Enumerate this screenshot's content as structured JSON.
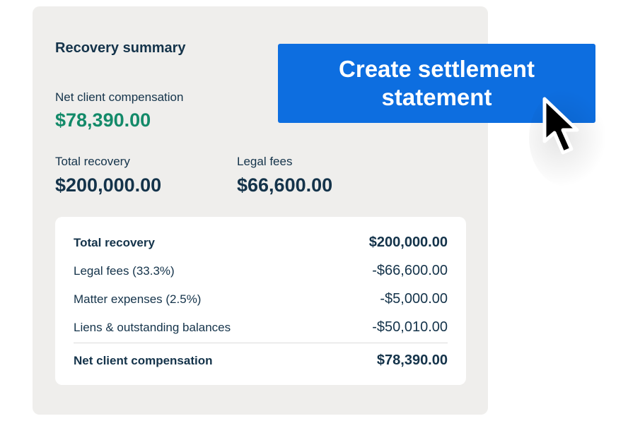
{
  "summary": {
    "title": "Recovery summary",
    "net_label": "Net client compensation",
    "net_value": "$78,390.00",
    "total_label": "Total recovery",
    "total_value": "$200,000.00",
    "fees_label": "Legal fees",
    "fees_value": "$66,600.00"
  },
  "breakdown": {
    "rows": [
      {
        "label": "Total recovery",
        "value": "$200,000.00"
      },
      {
        "label": "Legal fees (33.3%)",
        "value": "-$66,600.00"
      },
      {
        "label": "Matter expenses (2.5%)",
        "value": "-$5,000.00"
      },
      {
        "label": "Liens & outstanding balances",
        "value": "-$50,010.00"
      },
      {
        "label": "Net client compensation",
        "value": "$78,390.00"
      }
    ]
  },
  "cta": {
    "label": "Create settlement statement"
  },
  "icons": {
    "cursor": "mouse-pointer-icon"
  },
  "colors": {
    "accent": "#0d6ee0",
    "positive": "#138a69",
    "text": "#14334a",
    "card_bg": "#efeeec"
  }
}
